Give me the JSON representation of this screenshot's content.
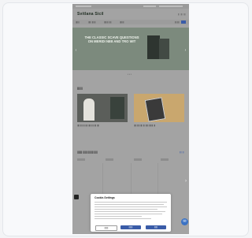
{
  "site": {
    "logo": "Svitlana Sicil",
    "header_links": "|||  ||||  ||||"
  },
  "nav": {
    "items": [
      "||||||",
      "||||| ||||||",
      "||||||| ||||",
      "|||||||"
    ],
    "search_label": "||||||||",
    "cart_icon": "cart-icon"
  },
  "hero": {
    "title": "THE CLASSIC SCAVE QUESTIONS ON MERIDI NIIB AND TRO WIT",
    "left_arrow": "‹",
    "right_arrow": "›",
    "dots": "• • •"
  },
  "section1": {
    "title": "||||||",
    "tiles": [
      {
        "caption": "|||| |||| ||| |||| ||||| ||| |||| ||||"
      },
      {
        "caption": "|||| ||||| |||| ||| ||||| ||||||| |||"
      }
    ]
  },
  "section2": {
    "title": "||||||| |||||| |||||||| |||||",
    "see_all": "|||| |||"
  },
  "cookie": {
    "title": "Cookie-Settings",
    "buttons": [
      "|||||||",
      "|||||||",
      "||||||"
    ]
  },
  "chat": {
    "icon": "chat-icon"
  },
  "colors": {
    "accent": "#3a5ca8",
    "hero_bg": "#7c8a7d"
  }
}
